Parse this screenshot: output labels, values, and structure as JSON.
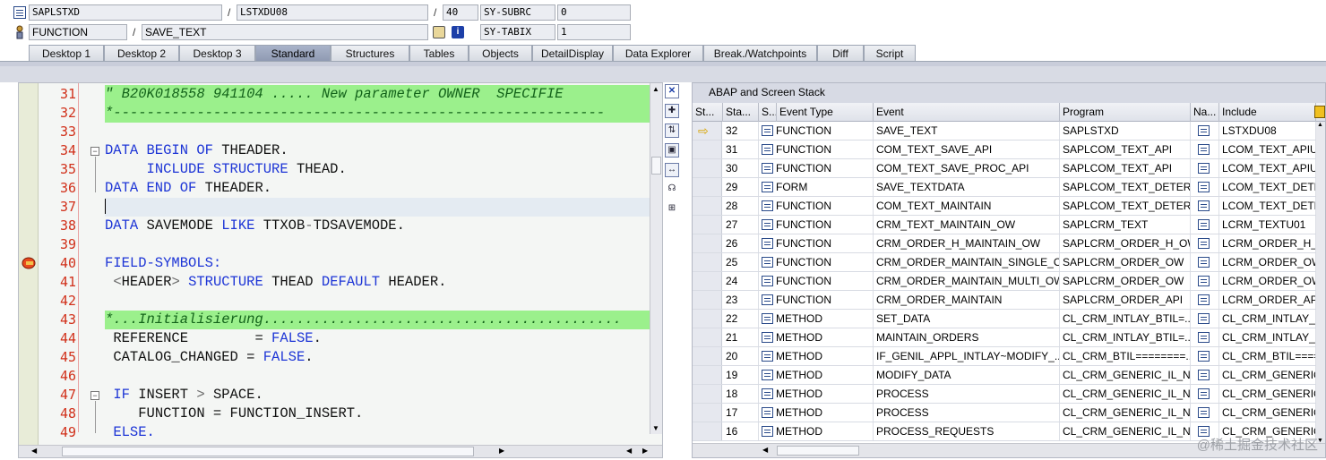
{
  "header": {
    "program_field": "SAPLSTXD",
    "include_field": "LSTXDU08",
    "line_field": "40",
    "sysvar1_name": "SY-SUBRC",
    "sysvar1_value": "0",
    "type_field": "FUNCTION",
    "name_field": "SAVE_TEXT",
    "sysvar2_name": "SY-TABIX",
    "sysvar2_value": "1",
    "slash": "/"
  },
  "tabs": [
    {
      "label": "Desktop 1"
    },
    {
      "label": "Desktop 2"
    },
    {
      "label": "Desktop 3"
    },
    {
      "label": "Standard"
    },
    {
      "label": "Structures"
    },
    {
      "label": "Tables"
    },
    {
      "label": "Objects"
    },
    {
      "label": "DetailDisplay"
    },
    {
      "label": "Data Explorer"
    },
    {
      "label": "Break./Watchpoints"
    },
    {
      "label": "Diff"
    },
    {
      "label": "Script"
    }
  ],
  "active_tab": "Standard",
  "editor": {
    "lines": [
      {
        "num": "31"
      },
      {
        "num": "32"
      },
      {
        "num": "33"
      },
      {
        "num": "34"
      },
      {
        "num": "35"
      },
      {
        "num": "36"
      },
      {
        "num": "37"
      },
      {
        "num": "38"
      },
      {
        "num": "39"
      },
      {
        "num": "40"
      },
      {
        "num": "41"
      },
      {
        "num": "42"
      },
      {
        "num": "43"
      },
      {
        "num": "44"
      },
      {
        "num": "45"
      },
      {
        "num": "46"
      },
      {
        "num": "47"
      },
      {
        "num": "48"
      },
      {
        "num": "49"
      }
    ],
    "code": {
      "l31": "\" B20K018558 941104 ..... New parameter OWNER  SPECIFIE",
      "l32": "*-----------------------------------------------------------",
      "l34_kw1": "DATA BEGIN OF",
      "l34_tx": " THEADER.",
      "l35_kw": "INCLUDE STRUCTURE",
      "l35_tx": " THEAD.",
      "l36_kw1": "DATA END OF",
      "l36_tx": " THEADER.",
      "l38_kw1": "DATA",
      "l38_tx1": " SAVEMODE ",
      "l38_kw2": "LIKE",
      "l38_tx2": " TTXOB",
      "l38_op": "-",
      "l38_tx3": "TDSAVEMODE.",
      "l40_kw": "FIELD-SYMBOLS:",
      "l41_op1": "<",
      "l41_tx1": "HEADER",
      "l41_op2": ">",
      "l41_kw1": "STRUCTURE",
      "l41_tx2": " THEAD ",
      "l41_kw2": "DEFAULT",
      "l41_tx3": " HEADER.",
      "l43": "*...Initialisierung...........................................",
      "l44_tx": "REFERENCE        = ",
      "l44_kw": "FALSE",
      "l44_end": ".",
      "l45_tx": "CATALOG_CHANGED = ",
      "l45_kw": "FALSE",
      "l45_end": ".",
      "l47_kw": "IF",
      "l47_tx": " INSERT ",
      "l47_op": ">",
      "l47_tx2": " SPACE.",
      "l48_tx": "FUNCTION = FUNCTION_INSERT.",
      "l49_kw": "ELSE."
    }
  },
  "stack": {
    "title": "ABAP and Screen Stack",
    "columns": [
      "St...",
      "Sta...",
      "S...",
      "Event Type",
      "Event",
      "Program",
      "Na...",
      "Include"
    ],
    "rows": [
      {
        "level": "32",
        "type": "FUNCTION",
        "event": "SAVE_TEXT",
        "program": "SAPLSTXD",
        "include": "LSTXDU08",
        "current": true
      },
      {
        "level": "31",
        "type": "FUNCTION",
        "event": "COM_TEXT_SAVE_API",
        "program": "SAPLCOM_TEXT_API",
        "include": "LCOM_TEXT_APIU("
      },
      {
        "level": "30",
        "type": "FUNCTION",
        "event": "COM_TEXT_SAVE_PROC_API",
        "program": "SAPLCOM_TEXT_API",
        "include": "LCOM_TEXT_APIU:"
      },
      {
        "level": "29",
        "type": "FORM",
        "event": "SAVE_TEXTDATA",
        "program": "SAPLCOM_TEXT_DETER...",
        "include": "LCOM_TEXT_DETE"
      },
      {
        "level": "28",
        "type": "FUNCTION",
        "event": "COM_TEXT_MAINTAIN",
        "program": "SAPLCOM_TEXT_DETER...",
        "include": "LCOM_TEXT_DETE"
      },
      {
        "level": "27",
        "type": "FUNCTION",
        "event": "CRM_TEXT_MAINTAIN_OW",
        "program": "SAPLCRM_TEXT",
        "include": "LCRM_TEXTU01"
      },
      {
        "level": "26",
        "type": "FUNCTION",
        "event": "CRM_ORDER_H_MAINTAIN_OW",
        "program": "SAPLCRM_ORDER_H_OW",
        "include": "LCRM_ORDER_H_O"
      },
      {
        "level": "25",
        "type": "FUNCTION",
        "event": "CRM_ORDER_MAINTAIN_SINGLE_OW",
        "program": "SAPLCRM_ORDER_OW",
        "include": "LCRM_ORDER_OWU"
      },
      {
        "level": "24",
        "type": "FUNCTION",
        "event": "CRM_ORDER_MAINTAIN_MULTI_OW",
        "program": "SAPLCRM_ORDER_OW",
        "include": "LCRM_ORDER_OWU"
      },
      {
        "level": "23",
        "type": "FUNCTION",
        "event": "CRM_ORDER_MAINTAIN",
        "program": "SAPLCRM_ORDER_API",
        "include": "LCRM_ORDER_APIU"
      },
      {
        "level": "22",
        "type": "METHOD",
        "event": "SET_DATA",
        "program": "CL_CRM_INTLAY_BTIL=...",
        "include": "CL_CRM_INTLAY_B"
      },
      {
        "level": "21",
        "type": "METHOD",
        "event": "MAINTAIN_ORDERS",
        "program": "CL_CRM_INTLAY_BTIL=...",
        "include": "CL_CRM_INTLAY_B"
      },
      {
        "level": "20",
        "type": "METHOD",
        "event": "IF_GENIL_APPL_INTLAY~MODIFY_...",
        "program": "CL_CRM_BTIL========...",
        "include": "CL_CRM_BTIL===="
      },
      {
        "level": "19",
        "type": "METHOD",
        "event": "MODIFY_DATA",
        "program": "CL_CRM_GENERIC_IL_NE...",
        "include": "CL_CRM_GENERIC_"
      },
      {
        "level": "18",
        "type": "METHOD",
        "event": "PROCESS",
        "program": "CL_CRM_GENERIC_IL_NE...",
        "include": "CL_CRM_GENERIC_"
      },
      {
        "level": "17",
        "type": "METHOD",
        "event": "PROCESS",
        "program": "CL_CRM_GENERIC_IL_NE...",
        "include": "CL_CRM_GENERIC_"
      },
      {
        "level": "16",
        "type": "METHOD",
        "event": "PROCESS_REQUESTS",
        "program": "CL_CRM_GENERIC_IL_NE...",
        "include": "CL_CRM_GENERIC_"
      }
    ]
  },
  "watermark": "@稀土掘金技术社区",
  "colors": {
    "line_number": "#d1301a",
    "keyword": "#1d35d6",
    "comment_band": "#9bf08c",
    "active_tab": "#8e99b1"
  }
}
